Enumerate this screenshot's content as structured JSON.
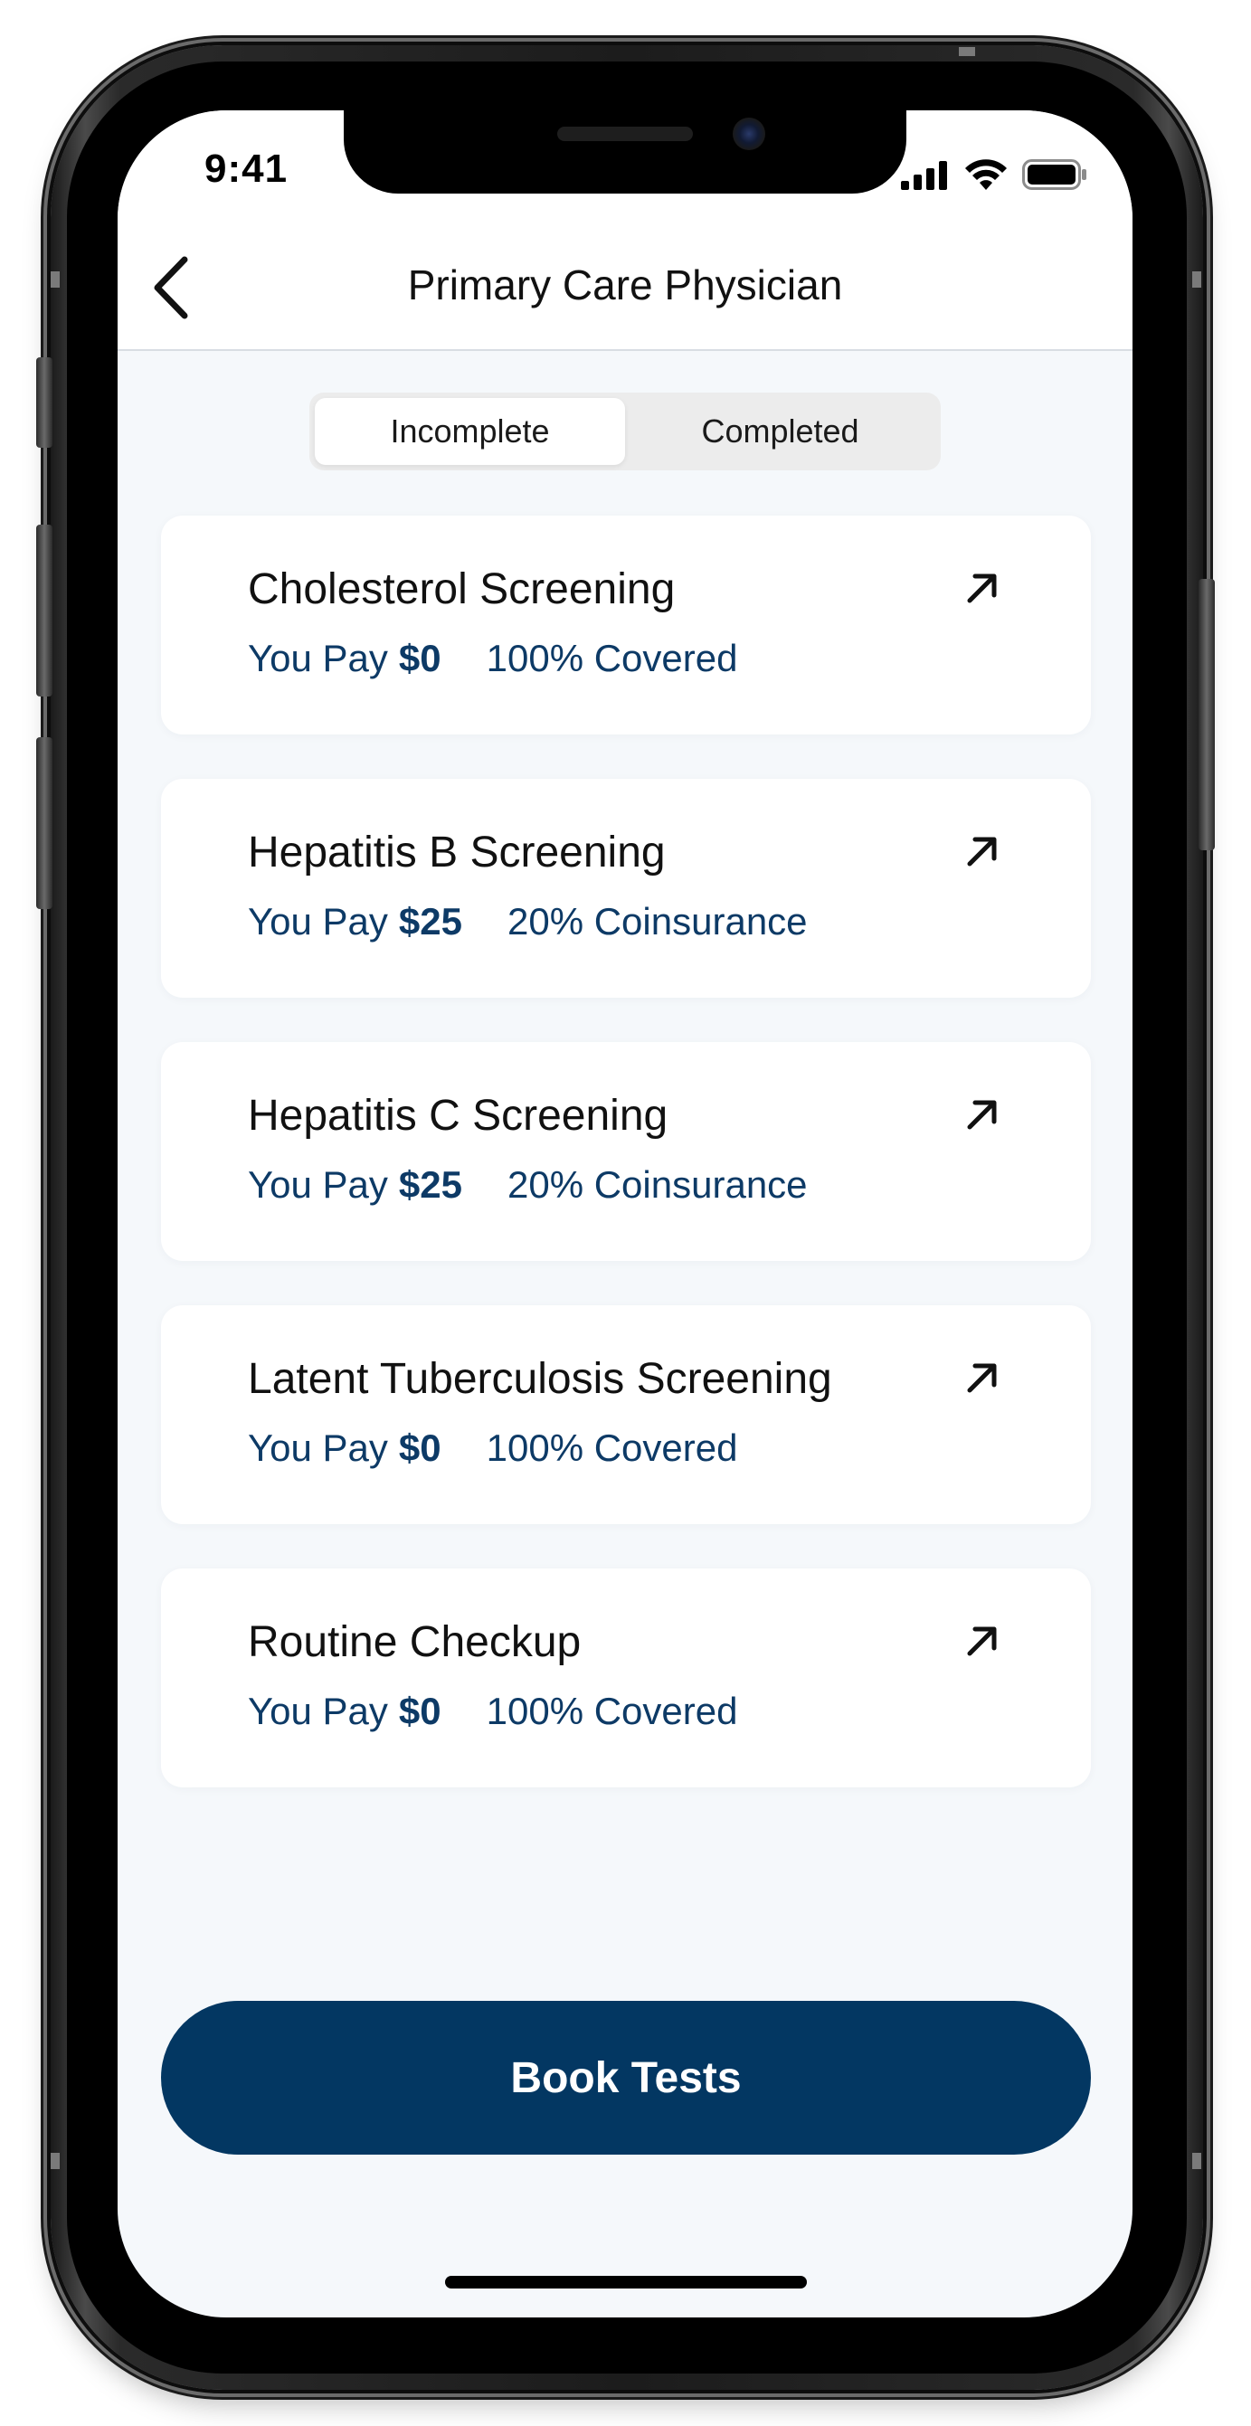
{
  "status_bar": {
    "time": "9:41",
    "icons": [
      "cellular-signal-icon",
      "wifi-icon",
      "battery-icon"
    ]
  },
  "header": {
    "back_icon": "chevron-left-icon",
    "title": "Primary Care Physician"
  },
  "segmented": {
    "tabs": [
      {
        "label": "Incomplete",
        "selected": true
      },
      {
        "label": "Completed",
        "selected": false
      }
    ]
  },
  "tests": [
    {
      "title": "Cholesterol Screening",
      "pay_label": "You Pay",
      "pay_amount": "$0",
      "coverage": "100% Covered",
      "icon": "arrow-up-right-icon"
    },
    {
      "title": "Hepatitis B Screening",
      "pay_label": "You Pay",
      "pay_amount": "$25",
      "coverage": "20% Coinsurance",
      "icon": "arrow-up-right-icon"
    },
    {
      "title": "Hepatitis C Screening",
      "pay_label": "You Pay",
      "pay_amount": "$25",
      "coverage": "20% Coinsurance",
      "icon": "arrow-up-right-icon"
    },
    {
      "title": "Latent Tuberculosis Screening",
      "pay_label": "You Pay",
      "pay_amount": "$0",
      "coverage": "100% Covered",
      "icon": "arrow-up-right-icon"
    },
    {
      "title": "Routine Checkup",
      "pay_label": "You Pay",
      "pay_amount": "$0",
      "coverage": "100% Covered",
      "icon": "arrow-up-right-icon"
    }
  ],
  "primary_action": {
    "label": "Book Tests"
  },
  "colors": {
    "brand_navy": "#033762",
    "meta_text": "#0d3a66",
    "screen_bg": "#f5f8fb",
    "card_bg": "#ffffff",
    "segment_bg": "#ececec"
  }
}
